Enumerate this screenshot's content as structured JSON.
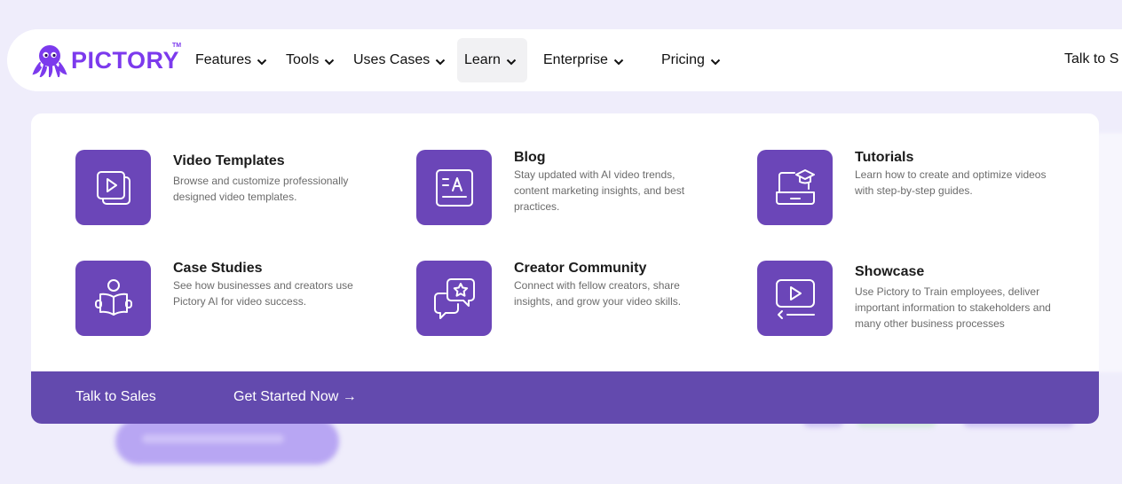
{
  "brand": {
    "name": "PICTORY",
    "tm": "TM",
    "accent": "#7c3aed"
  },
  "nav": {
    "items": [
      {
        "label": "Features"
      },
      {
        "label": "Tools"
      },
      {
        "label": "Uses Cases"
      },
      {
        "label": "Learn",
        "active": true
      },
      {
        "label": "Enterprise"
      },
      {
        "label": "Pricing"
      }
    ],
    "talk": "Talk to S"
  },
  "menu": {
    "tile_color": "#6b46b8",
    "items": [
      {
        "icon": "video-templates-icon",
        "title": "Video Templates",
        "desc": "Browse and customize professionally designed video templates."
      },
      {
        "icon": "blog-icon",
        "title": "Blog",
        "desc": "Stay updated with AI video trends, content marketing insights, and best practices."
      },
      {
        "icon": "tutorials-icon",
        "title": "Tutorials",
        "desc": "Learn how to create and optimize videos with step-by-step guides."
      },
      {
        "icon": "case-studies-icon",
        "title": "Case Studies",
        "desc": "See how businesses and creators use Pictory AI for video success."
      },
      {
        "icon": "creator-community-icon",
        "title": "Creator Community",
        "desc": "Connect with fellow creators, share insights, and grow your video skills."
      },
      {
        "icon": "showcase-icon",
        "title": "Showcase",
        "desc": "Use Pictory to Train employees, deliver important information to stakeholders and many other business processes"
      }
    ],
    "footer": {
      "talk_to_sales": "Talk to Sales",
      "get_started": "Get Started Now →",
      "bar_color": "#634aae"
    }
  }
}
